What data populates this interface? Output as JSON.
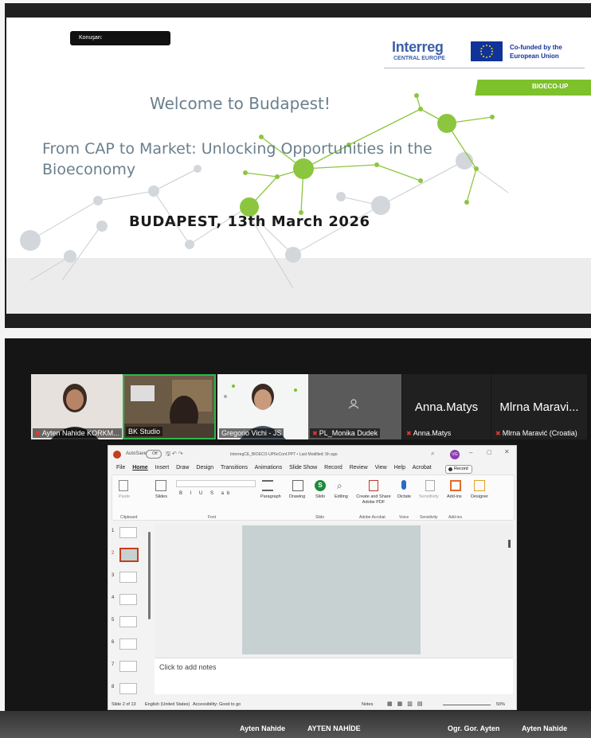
{
  "slide": {
    "speaker_label": "Konuşan:",
    "logo_interreg": "Interreg",
    "logo_central": "CENTRAL EUROPE",
    "cofunded": "Co-funded by the European Union",
    "project_badge": "BIOECO-UP",
    "welcome": "Welcome to Budapest!",
    "subtitle": "From CAP to Market: Unlocking Opportunities in the Bioeconomy",
    "city_date": "BUDAPEST, 13th March 2026"
  },
  "participants": [
    {
      "name": "Ayten Nahide KORKM...",
      "muted": true,
      "video": true
    },
    {
      "name": "BK Studio",
      "muted": false,
      "video": true,
      "active_speaker": true
    },
    {
      "name": "Gregorio Vichi - JS",
      "muted": false,
      "video": true
    },
    {
      "name": "PL_Monika Dudek",
      "muted": true,
      "video": false
    },
    {
      "name": "Anna.Matys",
      "display_name": "Anna.Matys",
      "muted": true,
      "video": false
    },
    {
      "name": "Mlrna Maravić (Croatia)",
      "display_name": "Mlrna Maravi...",
      "muted": true,
      "video": false
    }
  ],
  "ppt": {
    "autosave": "AutoSave",
    "autosave_state": "Off",
    "doc_title": "InterregCE_BIOECO-UP6nConf.PPT • Last Modified: 5h ago",
    "menu": [
      "File",
      "Home",
      "Insert",
      "Draw",
      "Design",
      "Transitions",
      "Animations",
      "Slide Show",
      "Record",
      "Review",
      "View",
      "Help",
      "Acrobat"
    ],
    "active_tab": "Home",
    "record_button": "Record",
    "avatar_initials": "VG",
    "ribbon": {
      "paste": "Paste",
      "slides": "Slides",
      "paragraph": "Paragraph",
      "drawing": "Drawing",
      "slido": "Slido",
      "editing": "Editing",
      "create_pdf": "Create and Share Adobe PDF",
      "dictate": "Dictate",
      "sensitivity": "Sensitivity",
      "addins": "Add-ins",
      "designer": "Designer"
    },
    "groups": [
      "Clipboard",
      "Font",
      "Slido",
      "Adobe Acrobat",
      "Voice",
      "Sensitivity",
      "Add-ins"
    ],
    "slide_numbers": [
      "1",
      "2",
      "3",
      "4",
      "5",
      "6",
      "7",
      "8"
    ],
    "selected_slide": "2",
    "notes_placeholder": "Click to add notes",
    "status": {
      "slide_count": "Slide 2 of 13",
      "language": "English (United States)",
      "accessibility": "Accessibility: Good to go",
      "notes": "Notes",
      "zoom": "50%"
    }
  },
  "bottom_names": [
    "Ayten Nahide",
    "AYTEN NAHİDE",
    "Ogr. Gor. Ayten",
    "Ayten Nahide"
  ]
}
